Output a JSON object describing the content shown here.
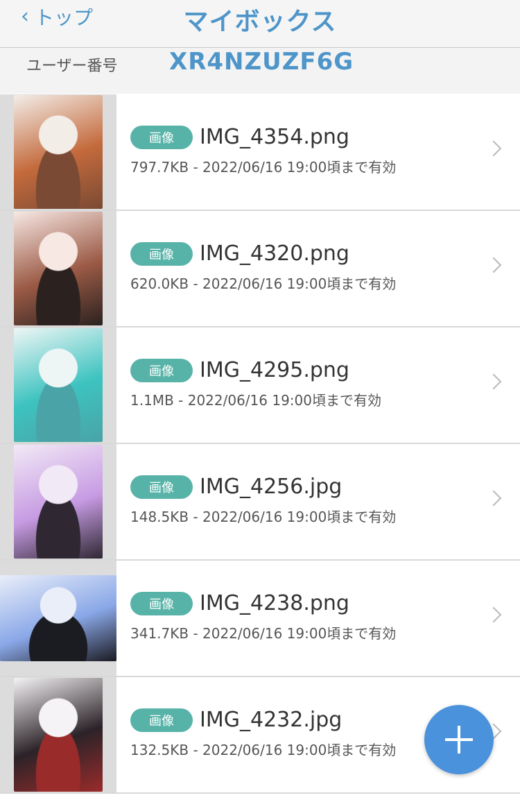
{
  "header": {
    "back_label": "トップ",
    "title": "マイボックス"
  },
  "user": {
    "label": "ユーザー番号",
    "id": "XR4NZUZF6G"
  },
  "files": [
    {
      "badge": "画像",
      "name": "IMG_4354.png",
      "meta": "797.7KB - 2022/06/16 19:00頃まで有効",
      "thumb_colors": [
        "#f3ede8",
        "#c46a3c",
        "#7a4a34"
      ]
    },
    {
      "badge": "画像",
      "name": "IMG_4320.png",
      "meta": "620.0KB - 2022/06/16 19:00頃まで有効",
      "thumb_colors": [
        "#f7e8e4",
        "#9b5a45",
        "#2b2220"
      ]
    },
    {
      "badge": "画像",
      "name": "IMG_4295.png",
      "meta": "1.1MB - 2022/06/16 19:00頃まで有効",
      "thumb_colors": [
        "#eef6f5",
        "#3dc3c0",
        "#4aa3a6"
      ]
    },
    {
      "badge": "画像",
      "name": "IMG_4256.jpg",
      "meta": "148.5KB - 2022/06/16 19:00頃まで有効",
      "thumb_colors": [
        "#f2e9f6",
        "#c79be3",
        "#2f2833"
      ]
    },
    {
      "badge": "画像",
      "name": "IMG_4238.png",
      "meta": "341.7KB - 2022/06/16 19:00頃まで有効",
      "thumb_colors": [
        "#e9eef9",
        "#8aa8e8",
        "#1b1b22"
      ]
    },
    {
      "badge": "画像",
      "name": "IMG_4232.jpg",
      "meta": "132.5KB - 2022/06/16 19:00頃まで有効",
      "thumb_colors": [
        "#f5f3f5",
        "#2b2328",
        "#9a2b2b"
      ]
    }
  ],
  "colors": {
    "accent": "#4e95c9",
    "badge": "#57b3a8",
    "fab": "#4a92dc"
  },
  "icons": {
    "back": "chevron-left-icon",
    "row_arrow": "chevron-right-icon",
    "fab": "plus-icon"
  }
}
